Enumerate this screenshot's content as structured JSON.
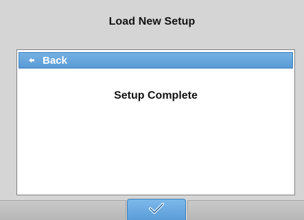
{
  "header": {
    "title": "Load New Setup"
  },
  "panel": {
    "back_label": "Back",
    "back_icon": "back-arrow-icon",
    "message": "Setup Complete"
  },
  "bottom_bar": {
    "ok_icon": "checkmark-icon"
  },
  "colors": {
    "background": "#d5d5d5",
    "accent_blue": "#5a9bd5",
    "panel": "#ffffff",
    "text": "#111111"
  }
}
